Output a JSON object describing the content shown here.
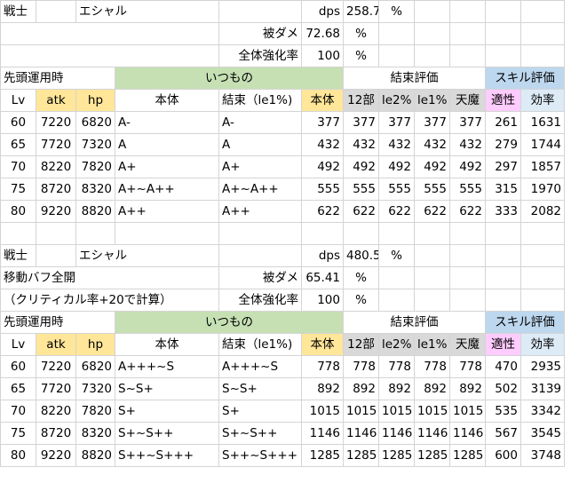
{
  "sections": [
    {
      "info": {
        "class": "戦士",
        "name": "エシャル",
        "note1": "",
        "note2": "",
        "dps_label": "dps",
        "dps": "258.7",
        "dps_unit": "%",
        "dmg_label": "被ダメ",
        "dmg": "72.68",
        "dmg_unit": "%",
        "boost_label": "全体強化率",
        "boost": "100",
        "boost_unit": "%"
      },
      "group_header": {
        "lead": "先頭運用時",
        "usual": "いつもの",
        "bind": "結束評価",
        "skill": "スキル評価"
      },
      "columns": [
        "Lv",
        "atk",
        "hp",
        "本体",
        "結束（le1%)",
        "本体",
        "12部",
        "le2%",
        "le1%",
        "天魔",
        "適性",
        "効率"
      ],
      "rows": [
        [
          "60",
          "7220",
          "6820",
          "A-",
          "A-",
          "377",
          "377",
          "377",
          "377",
          "377",
          "261",
          "1631"
        ],
        [
          "65",
          "7720",
          "7320",
          "A",
          "A",
          "432",
          "432",
          "432",
          "432",
          "432",
          "279",
          "1744"
        ],
        [
          "70",
          "8220",
          "7820",
          "A+",
          "A+",
          "492",
          "492",
          "492",
          "492",
          "492",
          "297",
          "1857"
        ],
        [
          "75",
          "8720",
          "8320",
          "A+~A++",
          "A+~A++",
          "555",
          "555",
          "555",
          "555",
          "555",
          "315",
          "1970"
        ],
        [
          "80",
          "9220",
          "8820",
          "A++",
          "A++",
          "622",
          "622",
          "622",
          "622",
          "622",
          "333",
          "2082"
        ]
      ]
    },
    {
      "info": {
        "class": "戦士",
        "name": "エシャル",
        "note1": "移動バフ全開",
        "note2": "（クリティカル率+20で計算）",
        "dps_label": "dps",
        "dps": "480.5",
        "dps_unit": "%",
        "dmg_label": "被ダメ",
        "dmg": "65.41",
        "dmg_unit": "%",
        "boost_label": "全体強化率",
        "boost": "100",
        "boost_unit": "%"
      },
      "group_header": {
        "lead": "先頭運用時",
        "usual": "いつもの",
        "bind": "結束評価",
        "skill": "スキル評価"
      },
      "columns": [
        "Lv",
        "atk",
        "hp",
        "本体",
        "結束（le1%)",
        "本体",
        "12部",
        "le2%",
        "le1%",
        "天魔",
        "適性",
        "効率"
      ],
      "rows": [
        [
          "60",
          "7220",
          "6820",
          "A+++~S",
          "A+++~S",
          "778",
          "778",
          "778",
          "778",
          "778",
          "470",
          "2935"
        ],
        [
          "65",
          "7720",
          "7320",
          "S~S+",
          "S~S+",
          "892",
          "892",
          "892",
          "892",
          "892",
          "502",
          "3139"
        ],
        [
          "70",
          "8220",
          "7820",
          "S+",
          "S+",
          "1015",
          "1015",
          "1015",
          "1015",
          "1015",
          "535",
          "3342"
        ],
        [
          "75",
          "8720",
          "8320",
          "S+~S++",
          "S+~S++",
          "1146",
          "1146",
          "1146",
          "1146",
          "1146",
          "567",
          "3545"
        ],
        [
          "80",
          "9220",
          "8820",
          "S++~S+++",
          "S++~S+++",
          "1285",
          "1285",
          "1285",
          "1285",
          "1285",
          "600",
          "3748"
        ]
      ]
    }
  ]
}
